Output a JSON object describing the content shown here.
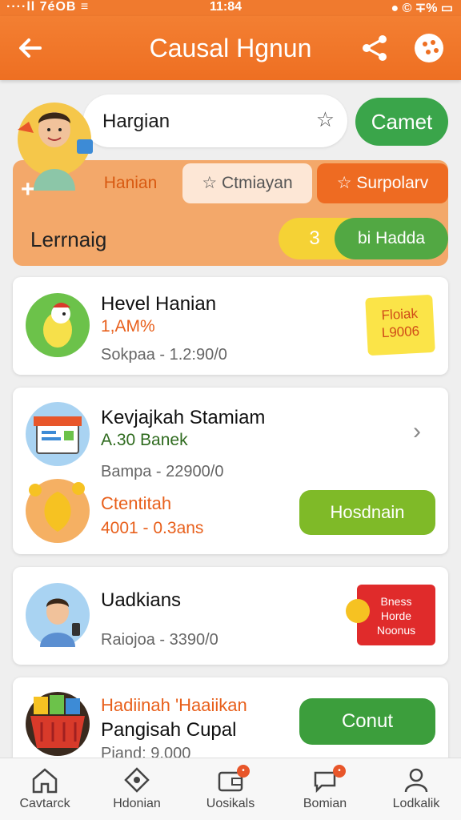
{
  "status_bar": {
    "left": "····ll 7éOB ≡",
    "time": "11:84",
    "right": "● © ∓% ▭"
  },
  "header": {
    "title": "Causal Hgnun",
    "back_icon": "arrow-left-icon",
    "share_icon": "share-icon",
    "more_icon": "cookie-icon"
  },
  "search": {
    "value": "Hargian",
    "star_icon": "star-icon",
    "cancel_label": "Camet"
  },
  "filters": {
    "plus": "+",
    "tabs": [
      {
        "label": "Hanian"
      },
      {
        "label": "☆ Ctmiayan"
      },
      {
        "label": "☆ Surpolarv"
      }
    ],
    "section_label": "Lerrnaig",
    "counter": "3",
    "counter_label": "bi Hadda"
  },
  "items": [
    {
      "title": "Hevel Hanian",
      "subtitle": "1,AM%",
      "meta": "Sokpaa - 1.2:90/0",
      "sticker": "Floiak L9006"
    },
    {
      "title": "Kevjajkah Stamiam",
      "subtitle": "A.30 Banek",
      "meta": "Bampa - 22900/0",
      "extra_title": "Ctentitah",
      "extra_sub": "4001 - 0.3ans",
      "action": "Hosdnain"
    },
    {
      "title": "Uadkians",
      "meta": "Raiojoa - 3390/0",
      "badge_lines": [
        "Bness",
        "Horde",
        "Noonus"
      ]
    },
    {
      "title_orange": "Hadiinah 'Haaiikan",
      "title": "Pangisah Cupal",
      "meta": "Piand: 9.000",
      "action": "Conut"
    }
  ],
  "nav": [
    {
      "label": "Cavtarck",
      "icon": "home-icon"
    },
    {
      "label": "Hdonian",
      "icon": "tag-icon"
    },
    {
      "label": "Uosikals",
      "icon": "wallet-icon",
      "badge": "•"
    },
    {
      "label": "Bomian",
      "icon": "chat-icon",
      "badge": "•"
    },
    {
      "label": "Lodkalik",
      "icon": "person-icon"
    }
  ],
  "colors": {
    "primary": "#f07a2e",
    "green": "#3aa54a",
    "lime": "#7fba28",
    "yellow": "#f5d235",
    "red": "#e02b2b"
  }
}
